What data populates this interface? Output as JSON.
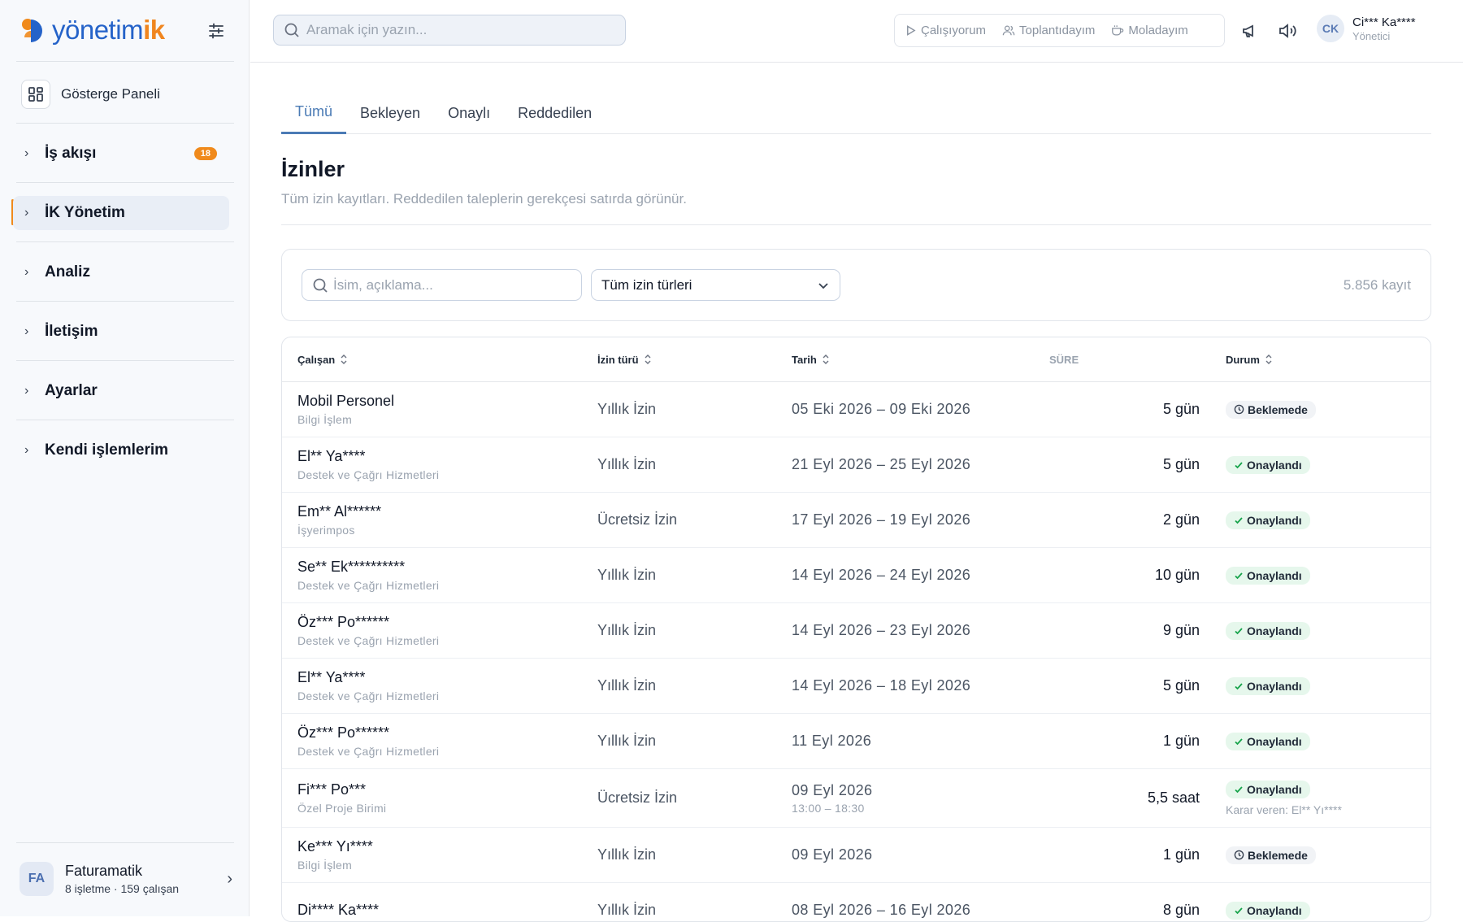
{
  "app": {
    "logo_main": "yönetim",
    "logo_accent": "ik"
  },
  "sidebar": {
    "dashboard_label": "Gösterge Paneli",
    "items": [
      {
        "label": "İş akışı",
        "badge": "18"
      },
      {
        "label": "İK Yönetim"
      },
      {
        "label": "Analiz"
      },
      {
        "label": "İletişim"
      },
      {
        "label": "Ayarlar"
      },
      {
        "label": "Kendi işlemlerim"
      }
    ],
    "org": {
      "initials": "FA",
      "name": "Faturamatik",
      "sub": "8 işletme · 159 çalışan"
    }
  },
  "topbar": {
    "search_placeholder": "Aramak için yazın...",
    "status": {
      "working": "Çalışıyorum",
      "meeting": "Toplantıdayım",
      "break": "Moladayım"
    },
    "user": {
      "initials": "CK",
      "name": "Ci*** Ka****",
      "role": "Yönetici"
    }
  },
  "tabs": [
    "Tümü",
    "Bekleyen",
    "Onaylı",
    "Reddedilen"
  ],
  "page": {
    "title": "İzinler",
    "subtitle": "Tüm izin kayıtları. Reddedilen taleplerin gerekçesi satırda görünür."
  },
  "filters": {
    "search_placeholder": "İsim, açıklama...",
    "type_select": "Tüm izin türleri",
    "count": "5.856 kayıt"
  },
  "table": {
    "headers": {
      "employee": "Çalışan",
      "type": "İzin türü",
      "date": "Tarih",
      "duration": "SÜRE",
      "status": "Durum"
    },
    "rows": [
      {
        "name": "Mobil Personel",
        "dept": "Bilgi İşlem",
        "type": "Yıllık İzin",
        "date": "05 Eki 2026 – 09 Eki 2026",
        "time": "",
        "duration": "5 gün",
        "status": "Beklemede",
        "decider": ""
      },
      {
        "name": "El** Ya****",
        "dept": "Destek ve Çağrı Hizmetleri",
        "type": "Yıllık İzin",
        "date": "21 Eyl 2026 – 25 Eyl 2026",
        "time": "",
        "duration": "5 gün",
        "status": "Onaylandı",
        "decider": ""
      },
      {
        "name": "Em** Al******",
        "dept": "İşyerimpos",
        "type": "Ücretsiz İzin",
        "date": "17 Eyl 2026 – 19 Eyl 2026",
        "time": "",
        "duration": "2 gün",
        "status": "Onaylandı",
        "decider": ""
      },
      {
        "name": "Se** Ek**********",
        "dept": "Destek ve Çağrı Hizmetleri",
        "type": "Yıllık İzin",
        "date": "14 Eyl 2026 – 24 Eyl 2026",
        "time": "",
        "duration": "10 gün",
        "status": "Onaylandı",
        "decider": ""
      },
      {
        "name": "Öz*** Po******",
        "dept": "Destek ve Çağrı Hizmetleri",
        "type": "Yıllık İzin",
        "date": "14 Eyl 2026 – 23 Eyl 2026",
        "time": "",
        "duration": "9 gün",
        "status": "Onaylandı",
        "decider": ""
      },
      {
        "name": "El** Ya****",
        "dept": "Destek ve Çağrı Hizmetleri",
        "type": "Yıllık İzin",
        "date": "14 Eyl 2026 – 18 Eyl 2026",
        "time": "",
        "duration": "5 gün",
        "status": "Onaylandı",
        "decider": ""
      },
      {
        "name": "Öz*** Po******",
        "dept": "Destek ve Çağrı Hizmetleri",
        "type": "Yıllık İzin",
        "date": "11 Eyl 2026",
        "time": "",
        "duration": "1 gün",
        "status": "Onaylandı",
        "decider": ""
      },
      {
        "name": "Fi*** Po***",
        "dept": "Özel Proje Birimi",
        "type": "Ücretsiz İzin",
        "date": "09 Eyl 2026",
        "time": "13:00 – 18:30",
        "duration": "5,5 saat",
        "status": "Onaylandı",
        "decider": "Karar veren: El** Yı****"
      },
      {
        "name": "Ke*** Yı****",
        "dept": "Bilgi İşlem",
        "type": "Yıllık İzin",
        "date": "09 Eyl 2026",
        "time": "",
        "duration": "1 gün",
        "status": "Beklemede",
        "decider": ""
      },
      {
        "name": "Di**** Ka****",
        "dept": "",
        "type": "Yıllık İzin",
        "date": "08 Eyl 2026 – 16 Eyl 2026",
        "time": "",
        "duration": "8 gün",
        "status": "Onaylandı",
        "decider": ""
      }
    ]
  },
  "colors": {
    "brand_blue": "#2563c9",
    "brand_orange": "#f08a1c",
    "approved_bg": "#e6f7ec",
    "pending_bg": "#f1f3f6"
  }
}
